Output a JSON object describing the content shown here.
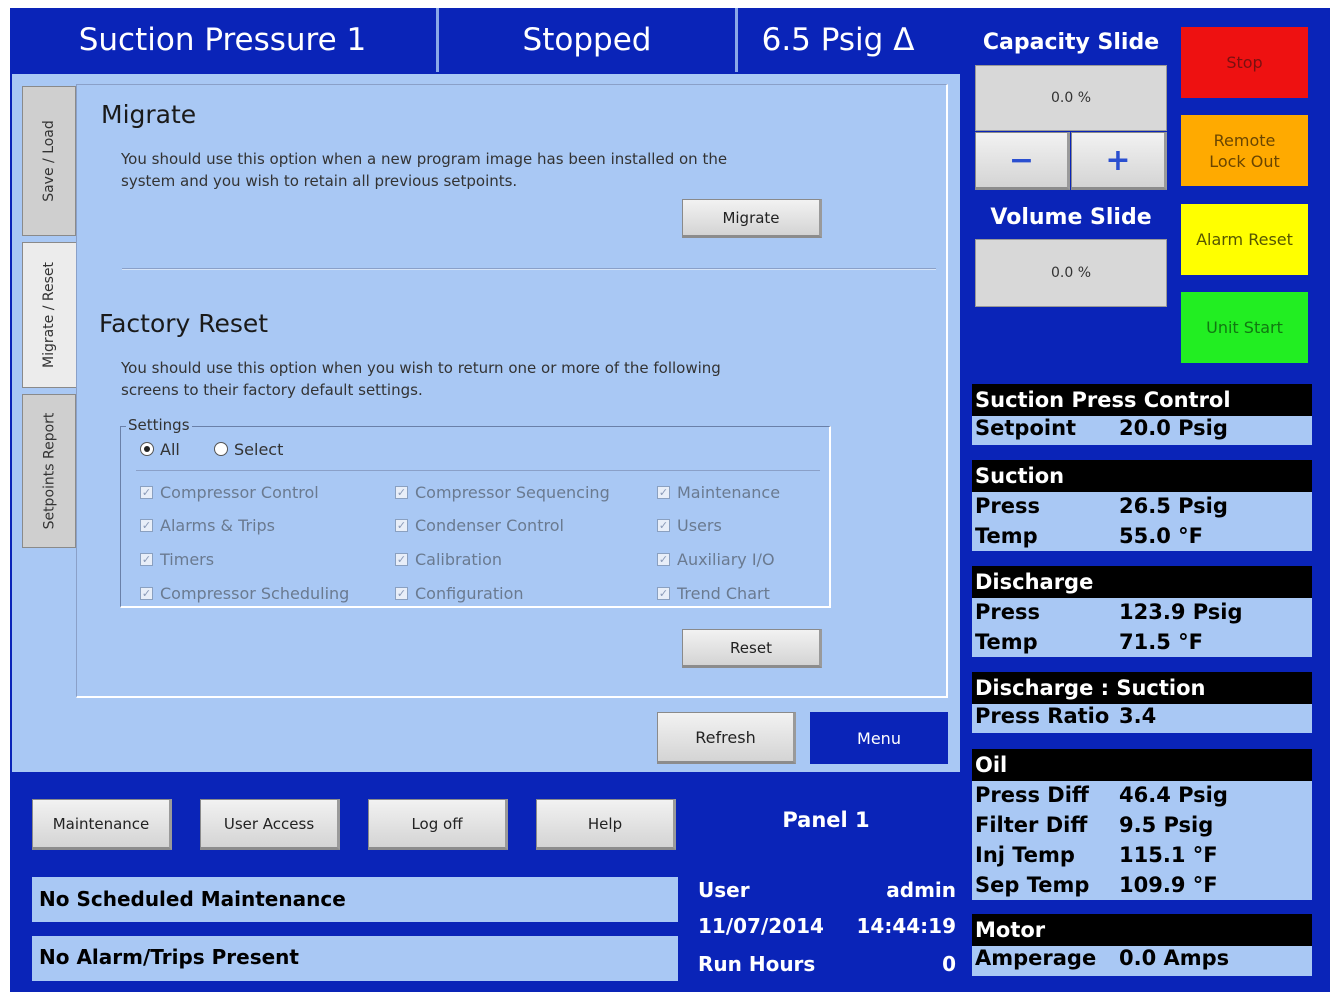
{
  "header": {
    "title": "Suction Pressure 1",
    "status": "Stopped",
    "value": "6.5 Psig Δ"
  },
  "tabs": [
    "Save / Load",
    "Migrate / Reset",
    "Setpoints Report"
  ],
  "migrate": {
    "heading": "Migrate",
    "description_line1": "You should use this option when a new program image has been installed on the",
    "description_line2": "system and you wish to retain all previous setpoints.",
    "button": "Migrate"
  },
  "factory_reset": {
    "heading": "Factory Reset",
    "description_line1": "You should use this option when you wish to return one or more of the following",
    "description_line2": "screens to their factory default settings.",
    "group_label": "Settings",
    "radio_all": "All",
    "radio_select": "Select",
    "checkboxes": [
      "Compressor Control",
      "Alarms & Trips",
      "Timers",
      "Compressor Scheduling",
      "Compressor Sequencing",
      "Condenser Control",
      "Calibration",
      "Configuration",
      "Maintenance",
      "Users",
      "Auxiliary I/O",
      "Trend Chart"
    ],
    "button": "Reset"
  },
  "actions": {
    "refresh": "Refresh",
    "menu": "Menu"
  },
  "footer": {
    "buttons": [
      "Maintenance",
      "User Access",
      "Log off",
      "Help"
    ],
    "panel": "Panel 1",
    "maintenance_status": "No Scheduled Maintenance",
    "alarm_status": "No Alarm/Trips Present",
    "user_label": "User",
    "user_value": "admin",
    "date": "11/07/2014",
    "time": "14:44:19",
    "run_hours_label": "Run Hours",
    "run_hours_value": "0"
  },
  "capacity_slide": {
    "label": "Capacity Slide",
    "value": "0.0 %",
    "minus": "−",
    "plus": "+"
  },
  "volume_slide": {
    "label": "Volume Slide",
    "value": "0.0 %"
  },
  "control_buttons": {
    "stop": "Stop",
    "remote_lock_out_1": "Remote",
    "remote_lock_out_2": "Lock Out",
    "alarm_reset": "Alarm Reset",
    "unit_start": "Unit Start"
  },
  "status_panel": {
    "suction_press_control": {
      "title": "Suction Press Control",
      "setpoint_label": "Setpoint",
      "setpoint_value": "20.0 Psig"
    },
    "suction": {
      "title": "Suction",
      "press_label": "Press",
      "press_value": "26.5 Psig",
      "temp_label": "Temp",
      "temp_value": "55.0 °F"
    },
    "discharge": {
      "title": "Discharge",
      "press_label": "Press",
      "press_value": "123.9 Psig",
      "temp_label": "Temp",
      "temp_value": "71.5 °F"
    },
    "ratio": {
      "title": "Discharge : Suction",
      "label": "Press Ratio",
      "value": "3.4"
    },
    "oil": {
      "title": "Oil",
      "press_diff_label": "Press Diff",
      "press_diff_value": "46.4 Psig",
      "filter_diff_label": "Filter Diff",
      "filter_diff_value": "9.5 Psig",
      "inj_temp_label": "Inj Temp",
      "inj_temp_value": "115.1 °F",
      "sep_temp_label": "Sep Temp",
      "sep_temp_value": "109.9 °F"
    },
    "motor": {
      "title": "Motor",
      "amperage_label": "Amperage",
      "amperage_value": "0.0 Amps"
    }
  },
  "colors": {
    "navy": "#0a24b8",
    "light_blue": "#a9c8f4",
    "stop": "#ee1111",
    "remote_lock_out": "#ffaa00",
    "alarm_reset": "#ffff00",
    "unit_start": "#22ee22"
  }
}
